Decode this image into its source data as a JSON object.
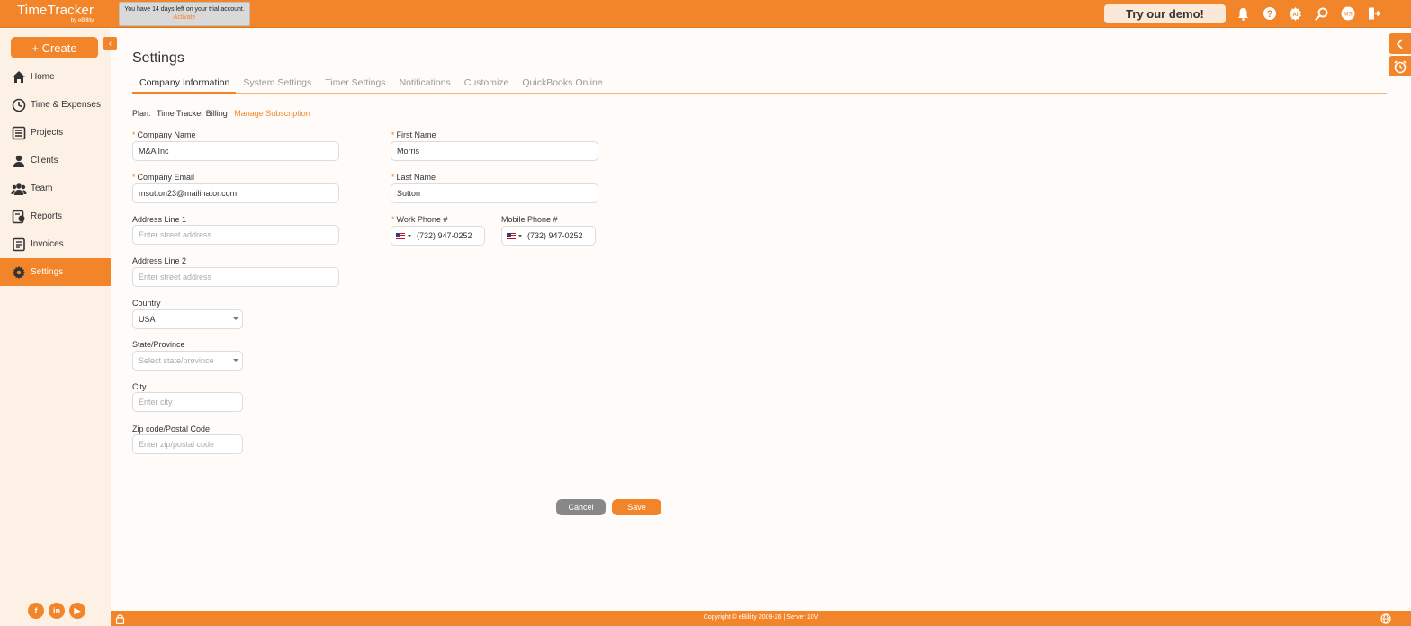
{
  "brand": {
    "name": "TimeTracker",
    "by": "by eBillity"
  },
  "trial": {
    "message": "You have 14 days left on your trial account.",
    "activate": "Activate"
  },
  "header": {
    "demo_label": "Try our demo!",
    "icons": [
      "bell-icon",
      "help-icon",
      "ai-icon",
      "search-icon",
      "user-avatar",
      "logout-icon"
    ],
    "avatar_initials": "MS"
  },
  "sidebar": {
    "create_label": "+ Create",
    "items": [
      {
        "label": "Home",
        "icon": "home-icon"
      },
      {
        "label": "Time & Expenses",
        "icon": "clock-icon"
      },
      {
        "label": "Projects",
        "icon": "projects-icon"
      },
      {
        "label": "Clients",
        "icon": "clients-icon"
      },
      {
        "label": "Team",
        "icon": "team-icon"
      },
      {
        "label": "Reports",
        "icon": "reports-icon"
      },
      {
        "label": "Invoices",
        "icon": "invoices-icon"
      },
      {
        "label": "Settings",
        "icon": "gear-icon",
        "active": true
      }
    ],
    "social": [
      "f",
      "in",
      "▶"
    ]
  },
  "page": {
    "title": "Settings",
    "tabs": [
      {
        "label": "Company Information",
        "active": true
      },
      {
        "label": "System Settings"
      },
      {
        "label": "Timer Settings"
      },
      {
        "label": "Notifications"
      },
      {
        "label": "Customize"
      },
      {
        "label": "QuickBooks Online"
      }
    ],
    "plan": {
      "label": "Plan:",
      "name": "Time Tracker Billing",
      "manage": "Manage Subscription"
    }
  },
  "form": {
    "company_name": {
      "label": "Company Name",
      "value": "M&A Inc"
    },
    "company_email": {
      "label": "Company Email",
      "value": "msutton23@mailinator.com"
    },
    "address1": {
      "label": "Address Line 1",
      "placeholder": "Enter street address"
    },
    "address2": {
      "label": "Address Line 2",
      "placeholder": "Enter street address"
    },
    "country": {
      "label": "Country",
      "value": "USA"
    },
    "state": {
      "label": "State/Province",
      "placeholder": "Select state/province"
    },
    "city": {
      "label": "City",
      "placeholder": "Enter city"
    },
    "zip": {
      "label": "Zip code/Postal Code",
      "placeholder": "Enter zip/postal code"
    },
    "first_name": {
      "label": "First Name",
      "value": "Morris"
    },
    "last_name": {
      "label": "Last Name",
      "value": "Sutton"
    },
    "work_phone": {
      "label": "Work Phone #",
      "value": "(732) 947-0252"
    },
    "mobile_phone": {
      "label": "Mobile Phone #",
      "value": "(732) 947-0252"
    },
    "required_marker": "*"
  },
  "actions": {
    "cancel": "Cancel",
    "save": "Save"
  },
  "footer": {
    "text": "Copyright © eBillity 2009-26 | Server 10V"
  },
  "colors": {
    "accent": "#f2852a",
    "sidebar_bg": "#fdf1e6",
    "page_bg": "#fffbf8"
  }
}
